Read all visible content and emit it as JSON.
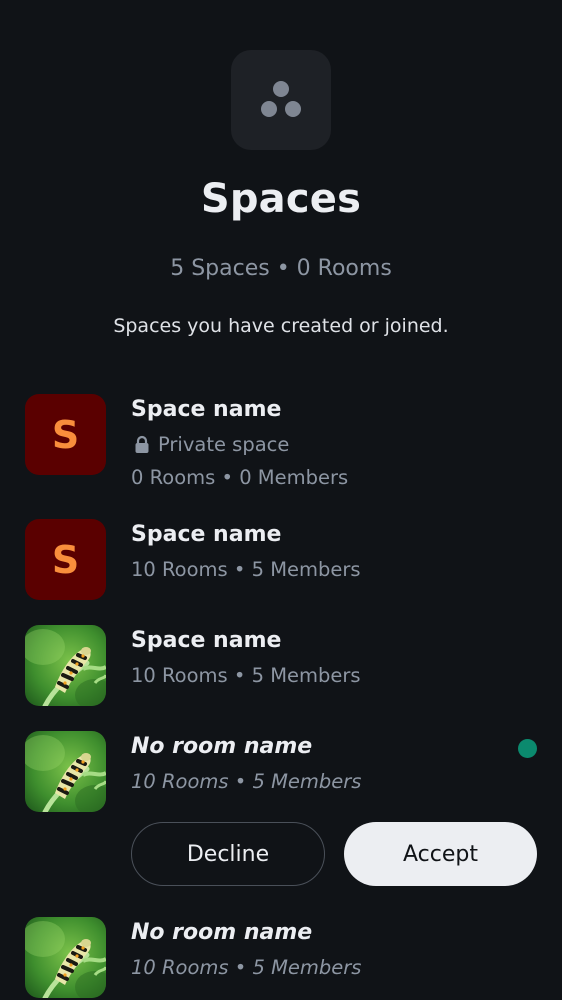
{
  "header": {
    "icon": "spaces-icon",
    "title": "Spaces",
    "counts": "5 Spaces • 0 Rooms",
    "subtitle": "Spaces you have created or joined."
  },
  "spaces": [
    {
      "avatar": "S",
      "name": "Space name",
      "privacy": "Private space",
      "meta": "0 Rooms • 0 Members"
    },
    {
      "avatar": "S",
      "name": "Space name",
      "meta": "10 Rooms • 5 Members"
    },
    {
      "avatar": "caterpillar-photo",
      "name": "Space name",
      "meta": "10 Rooms • 5 Members"
    },
    {
      "avatar": "caterpillar-photo",
      "name": "No room name",
      "meta": "10 Rooms • 5 Members",
      "unread": true,
      "actions": {
        "decline": "Decline",
        "accept": "Accept"
      }
    },
    {
      "avatar": "caterpillar-photo",
      "name": "No room name",
      "meta": "10 Rooms • 5 Members"
    }
  ],
  "colors": {
    "background": "#101317",
    "letter_avatar_bg": "#5a0000",
    "letter_avatar_fg": "#f98e3c",
    "secondary_text": "#8d96a3",
    "unread_dot": "#0b8a6e",
    "accept_bg": "#eceef2"
  }
}
